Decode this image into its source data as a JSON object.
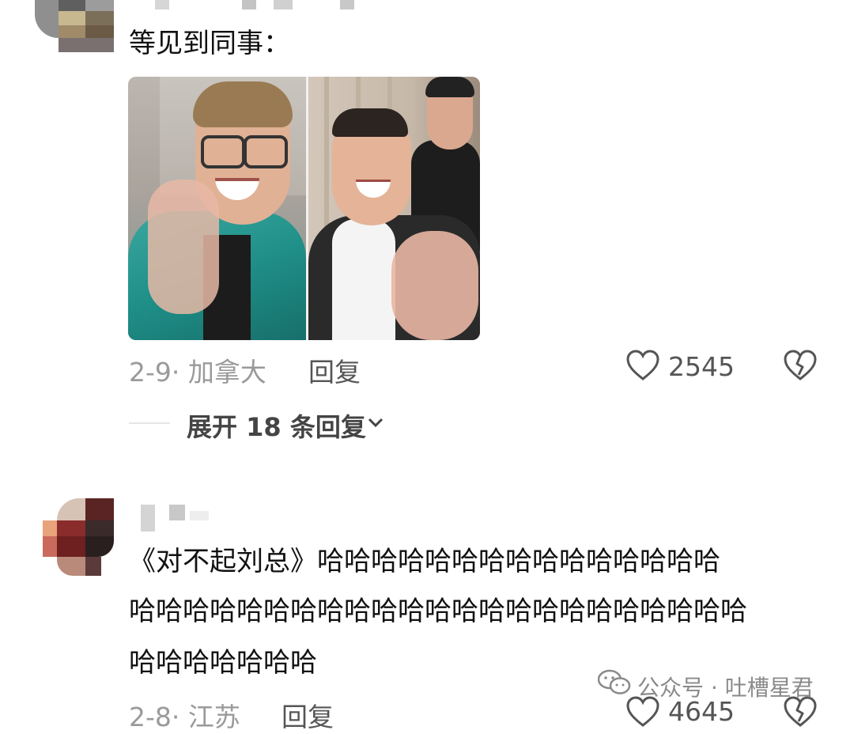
{
  "comment1": {
    "text": "等见到同事：",
    "meta": "2-9· 加拿大",
    "reply_label": "回复",
    "likes": "2545",
    "expand_label": "展开 18 条回复"
  },
  "comment2": {
    "line1": "《对不起刘总》哈哈哈哈哈哈哈哈哈哈哈哈哈哈哈",
    "line2": "哈哈哈哈哈哈哈哈哈哈哈哈哈哈哈哈哈哈哈哈哈哈哈",
    "line3": "哈哈哈哈哈哈哈",
    "meta": "2-8· 江苏",
    "reply_label": "回复",
    "likes": "4645"
  },
  "watermark": {
    "text": "公众号 · 吐槽星君"
  },
  "colors": {
    "meta_gray": "#9a9a9a",
    "text_dark": "#111111"
  }
}
